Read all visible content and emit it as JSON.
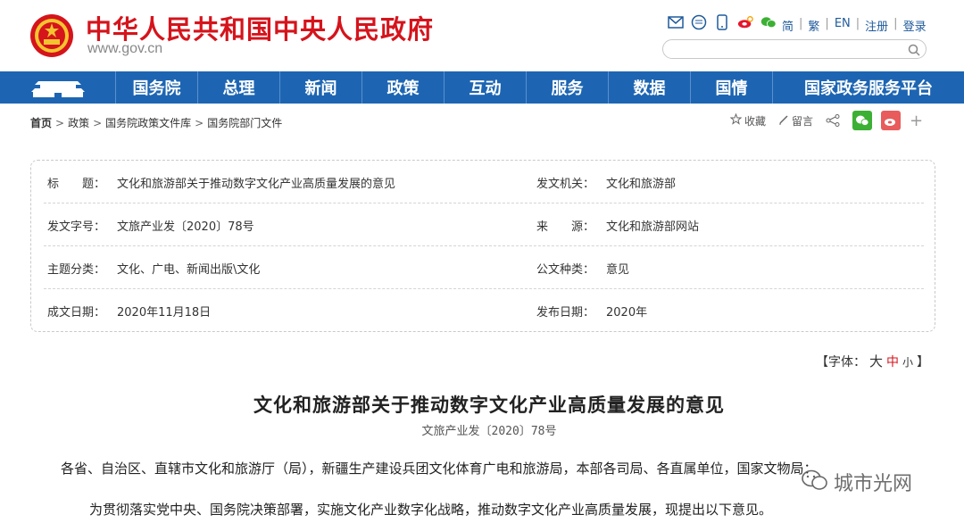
{
  "header": {
    "site_title": "中华人民共和国中央人民政府",
    "site_url": "www.gov.cn",
    "top_links": [
      "简",
      "繁",
      "EN",
      "注册",
      "登录"
    ],
    "search_placeholder": ""
  },
  "nav": {
    "items": [
      "国务院",
      "总理",
      "新闻",
      "政策",
      "互动",
      "服务",
      "数据",
      "国情",
      "国家政务服务平台"
    ]
  },
  "breadcrumb": [
    "首页",
    "政策",
    "国务院政策文件库",
    "国务院部门文件"
  ],
  "share": {
    "favorite": "收藏",
    "comment": "留言"
  },
  "info": {
    "rows": [
      {
        "label1": "标　　题：",
        "value1": "文化和旅游部关于推动数字文化产业高质量发展的意见",
        "label2": "发文机关：",
        "value2": "文化和旅游部"
      },
      {
        "label1": "发文字号：",
        "value1": "文旅产业发〔2020〕78号",
        "label2": "来　　源：",
        "value2": "文化和旅游部网站"
      },
      {
        "label1": "主题分类：",
        "value1": "文化、广电、新闻出版\\文化",
        "label2": "公文种类：",
        "value2": "意见"
      },
      {
        "label1": "成文日期：",
        "value1": "2020年11月18日",
        "label2": "发布日期：",
        "value2": "2020年"
      }
    ]
  },
  "font_switch": {
    "prefix": "【字体：",
    "big": "大",
    "mid": "中",
    "small": "小",
    "suffix": "】"
  },
  "article": {
    "title": "文化和旅游部关于推动数字文化产业高质量发展的意见",
    "doc_no": "文旅产业发〔2020〕78号",
    "para1": "各省、自治区、直辖市文化和旅游厅（局），新疆生产建设兵团文化体育广电和旅游局，本部各司局、各直属单位，国家文物局：",
    "para2": "为贯彻落实党中央、国务院决策部署，实施文化产业数字化战略，推动数字文化产业高质量发展，现提出以下意见。"
  },
  "watermark": {
    "text": "城市光网"
  },
  "colors": {
    "brand_red": "#d5141c",
    "nav_blue": "#1d65b2"
  }
}
